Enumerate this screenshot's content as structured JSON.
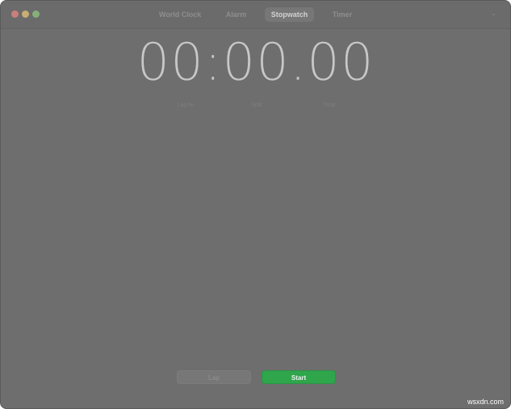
{
  "tabs": [
    {
      "label": "World Clock",
      "active": false
    },
    {
      "label": "Alarm",
      "active": false
    },
    {
      "label": "Stopwatch",
      "active": true
    },
    {
      "label": "Timer",
      "active": false
    }
  ],
  "stopwatch": {
    "time": "00:00.00"
  },
  "lap_table": {
    "headers": [
      "Lap №",
      "Split",
      "Total"
    ]
  },
  "buttons": {
    "lap_label": "Lap",
    "start_label": "Start"
  },
  "watermark": "wsxdn.com",
  "colors": {
    "window_bg": "#6e6e6e",
    "start_green": "#2fa54c"
  }
}
